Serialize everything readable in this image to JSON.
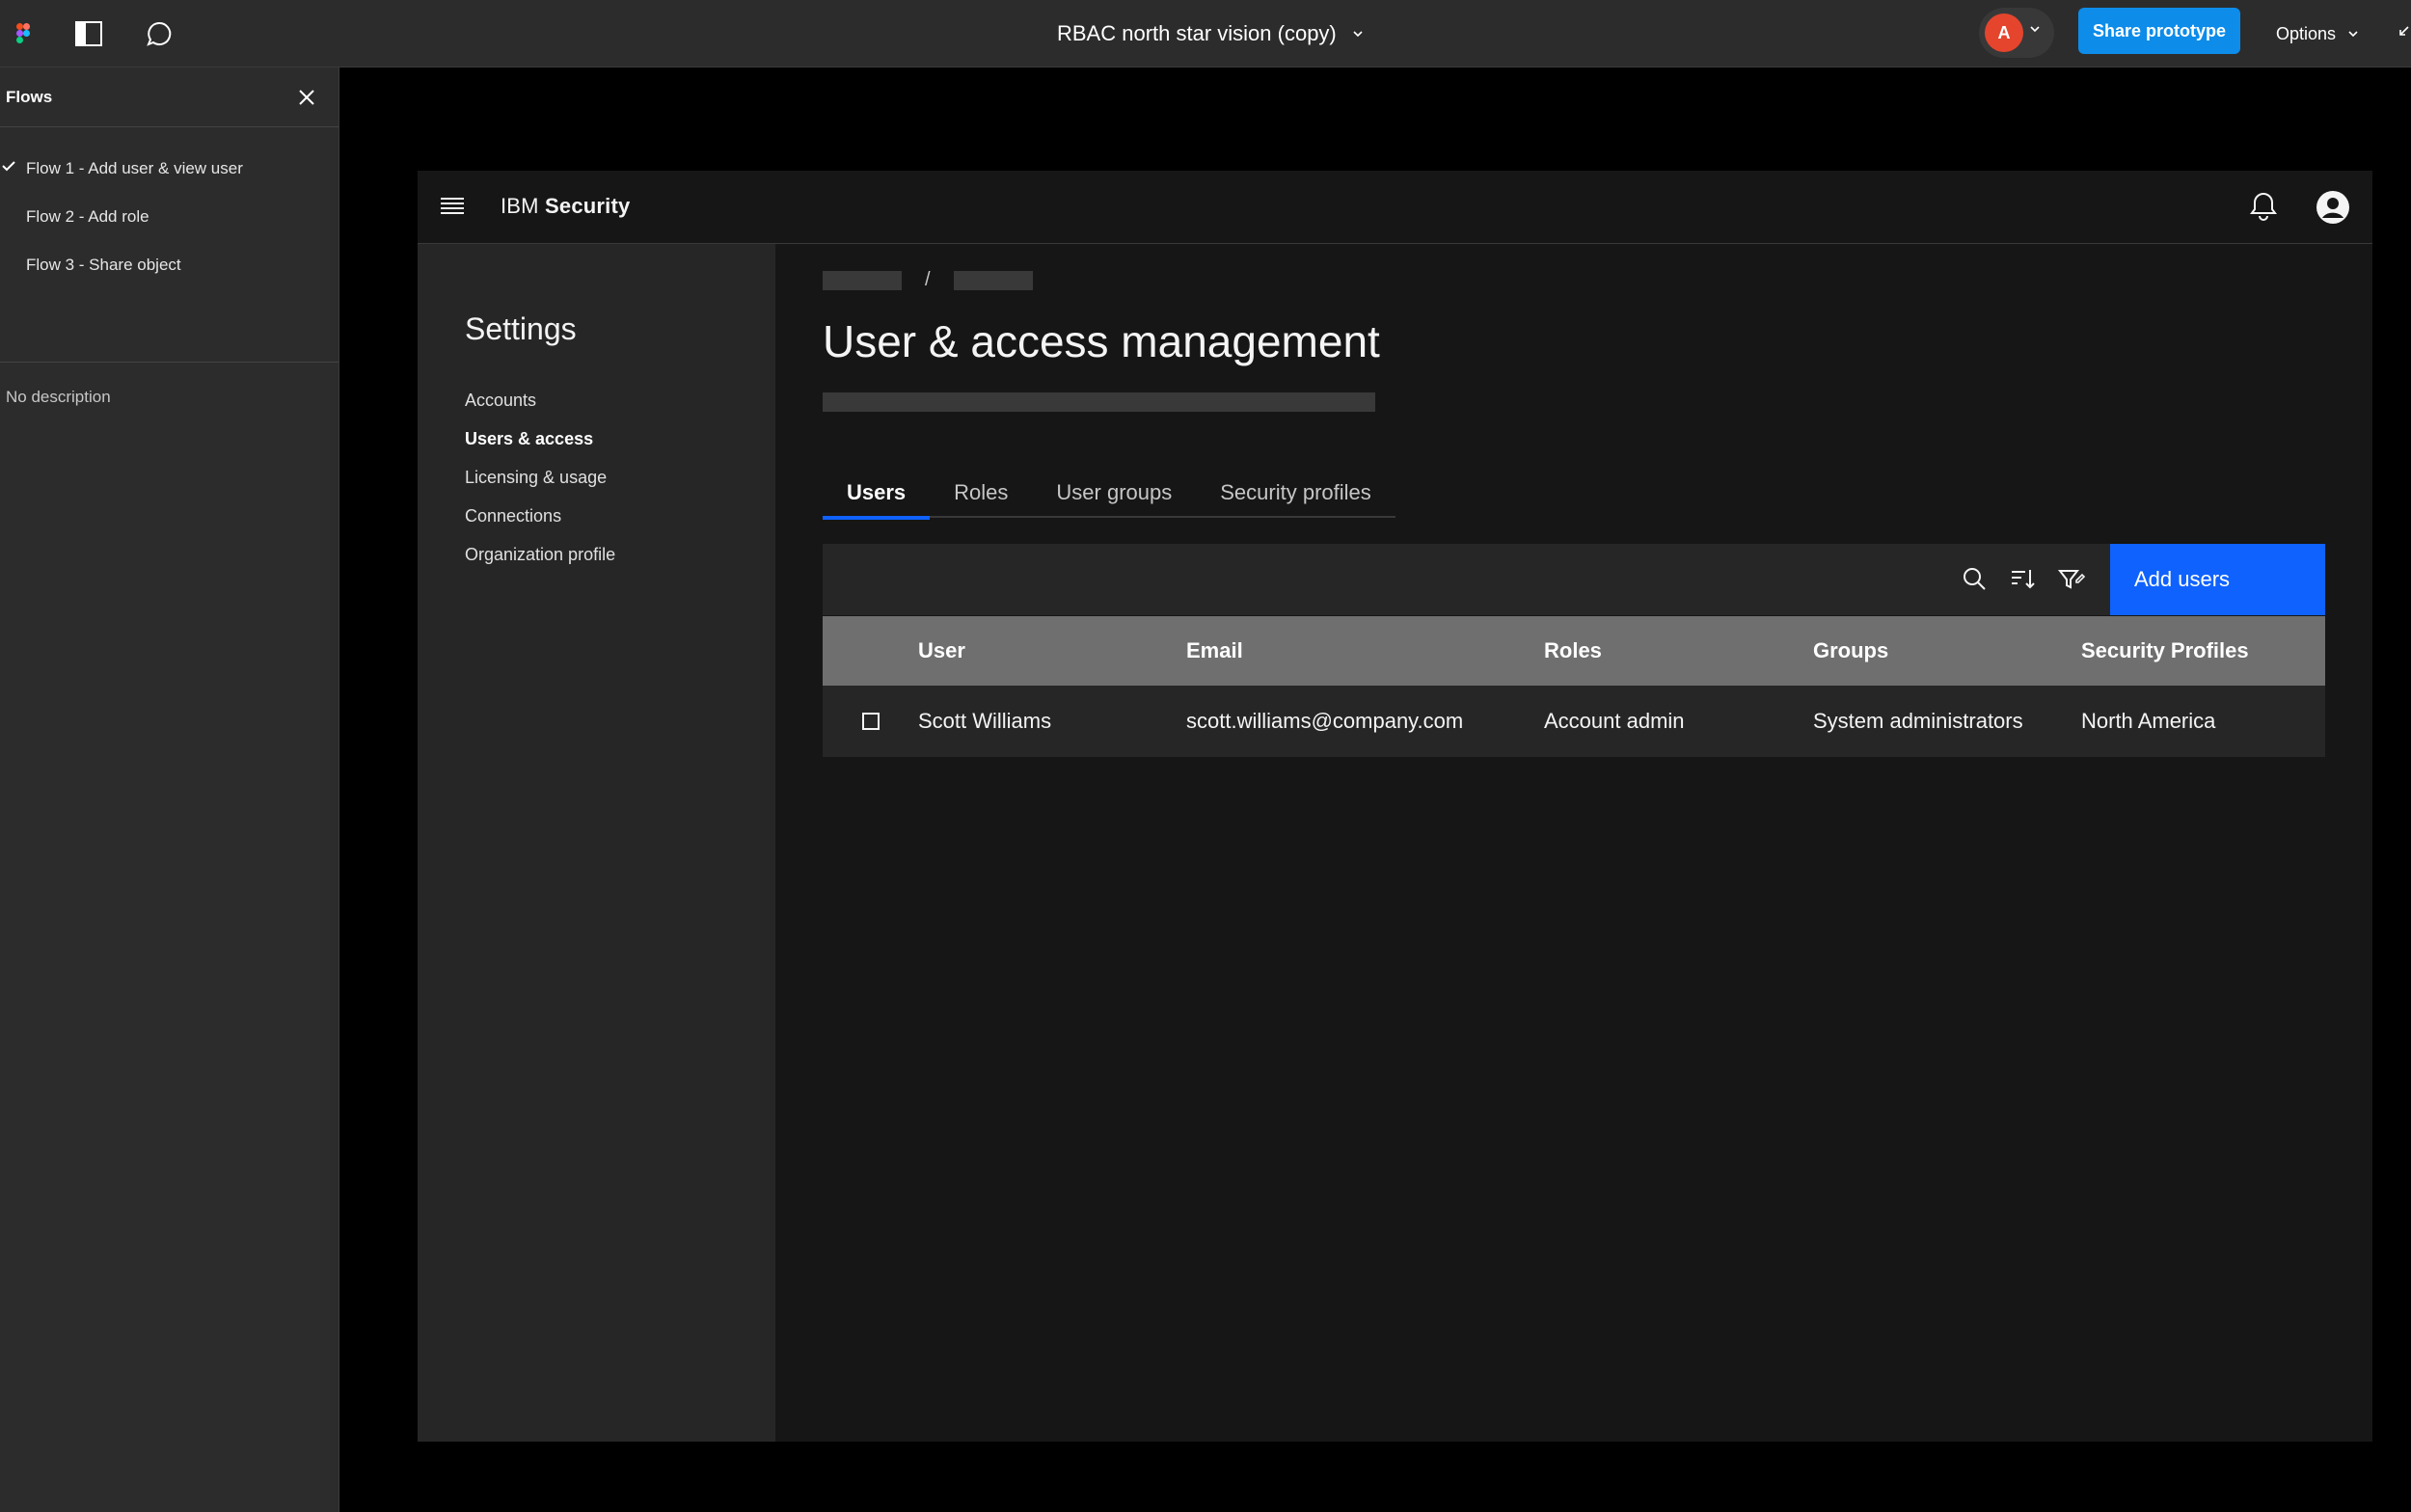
{
  "topbar": {
    "file_title": "RBAC north star vision (copy)",
    "avatar_letter": "A",
    "share_label": "Share prototype",
    "options_label": "Options"
  },
  "flows": {
    "title": "Flows",
    "items": [
      {
        "label": "Flow 1 - Add user & view user",
        "selected": true
      },
      {
        "label": "Flow 2 - Add role",
        "selected": false
      },
      {
        "label": "Flow 3 - Share object",
        "selected": false
      }
    ],
    "description": "No description"
  },
  "app": {
    "brand_prefix": "IBM",
    "brand_name": "Security",
    "settings": {
      "title": "Settings",
      "links": [
        "Accounts",
        "Users & access",
        "Licensing & usage",
        "Connections",
        "Organization profile"
      ],
      "active": "Users & access"
    },
    "breadcrumb_sep": "/",
    "page_title": "User & access management",
    "tabs": [
      "Users",
      "Roles",
      "User groups",
      "Security profiles"
    ],
    "active_tab": "Users",
    "add_users_label": "Add users",
    "table": {
      "headers": [
        "User",
        "Email",
        "Roles",
        "Groups",
        "Security Profiles"
      ],
      "rows": [
        [
          "Scott Williams",
          "scott.williams@company.com",
          "Account admin",
          "System administrators",
          "North America"
        ]
      ]
    }
  },
  "colors": {
    "figma_bar": "#2c2c2c",
    "share_blue": "#0d8ce9",
    "carbon_blue": "#0f62fe",
    "avatar_red": "#e5452d"
  }
}
